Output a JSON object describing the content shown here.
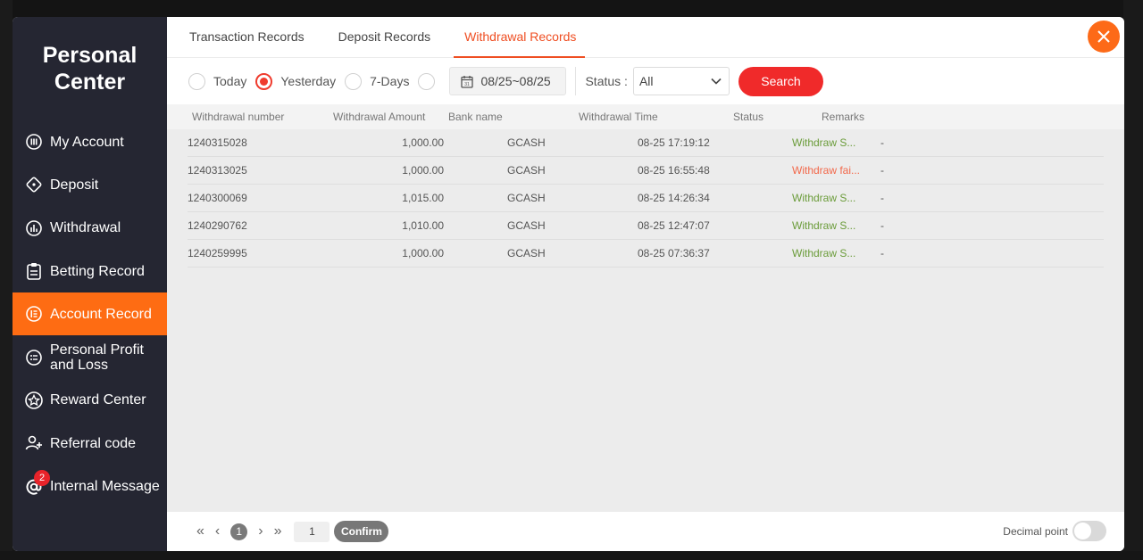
{
  "sidebar": {
    "title_line1": "Personal",
    "title_line2": "Center",
    "items": [
      {
        "label": "My Account",
        "icon": "account-icon"
      },
      {
        "label": "Deposit",
        "icon": "deposit-icon"
      },
      {
        "label": "Withdrawal",
        "icon": "withdrawal-icon"
      },
      {
        "label": "Betting Record",
        "icon": "clipboard-icon"
      },
      {
        "label": "Account Record",
        "icon": "record-icon",
        "active": true
      },
      {
        "label": "Personal Profit and Loss",
        "icon": "list-icon"
      },
      {
        "label": "Reward Center",
        "icon": "star-icon"
      },
      {
        "label": "Referral code",
        "icon": "user-add-icon"
      },
      {
        "label": "Internal Message",
        "icon": "at-icon",
        "badge": "2"
      }
    ]
  },
  "tabs": [
    {
      "label": "Transaction Records"
    },
    {
      "label": "Deposit Records"
    },
    {
      "label": "Withdrawal Records",
      "active": true
    }
  ],
  "filters": {
    "options": [
      {
        "label": "Today",
        "checked": false
      },
      {
        "label": "Yesterday",
        "checked": true
      },
      {
        "label": "7-Days",
        "checked": false
      },
      {
        "label": "",
        "checked": false
      }
    ],
    "date_range": "08/25~08/25",
    "status_label": "Status :",
    "status_value": "All",
    "search_label": "Search"
  },
  "table": {
    "headers": [
      "Withdrawal number",
      "Withdrawal Amount",
      "Bank name",
      "Withdrawal Time",
      "Status",
      "Remarks"
    ],
    "rows": [
      {
        "number": "1240315028",
        "amount": "1,000.00",
        "bank": "GCASH",
        "time": "08-25 17:19:12",
        "status": "Withdraw S...",
        "status_type": "ok",
        "remarks": "-"
      },
      {
        "number": "1240313025",
        "amount": "1,000.00",
        "bank": "GCASH",
        "time": "08-25 16:55:48",
        "status": "Withdraw fai...",
        "status_type": "fail",
        "remarks": "-"
      },
      {
        "number": "1240300069",
        "amount": "1,015.00",
        "bank": "GCASH",
        "time": "08-25 14:26:34",
        "status": "Withdraw S...",
        "status_type": "ok",
        "remarks": "-"
      },
      {
        "number": "1240290762",
        "amount": "1,010.00",
        "bank": "GCASH",
        "time": "08-25 12:47:07",
        "status": "Withdraw S...",
        "status_type": "ok",
        "remarks": "-"
      },
      {
        "number": "1240259995",
        "amount": "1,000.00",
        "bank": "GCASH",
        "time": "08-25 07:36:37",
        "status": "Withdraw S...",
        "status_type": "ok",
        "remarks": "-"
      }
    ]
  },
  "pagination": {
    "current_page": "1",
    "page_input": "1",
    "confirm_label": "Confirm"
  },
  "footer": {
    "decimal_label": "Decimal point",
    "decimal_on": false
  },
  "colors": {
    "accent": "#fe6c13",
    "active_tab": "#ef4e22",
    "search_button": "#f02a2a",
    "sidebar_bg": "#252632",
    "status_success": "#6b9c3a",
    "status_fail": "#f2684a"
  }
}
